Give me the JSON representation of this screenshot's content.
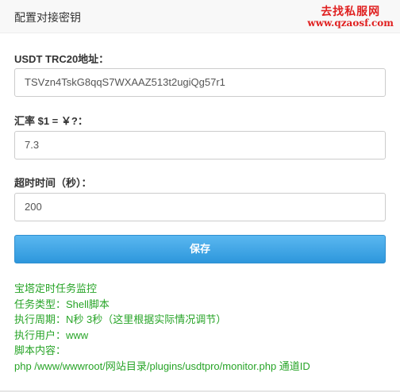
{
  "dialog": {
    "title": "配置对接密钥",
    "watermark_line1": "去找私服网",
    "watermark_line2": "www.qzaosf.com",
    "close_glyph": "×"
  },
  "form": {
    "usdt_label": "USDT TRC20地址：",
    "usdt_value": "TSVzn4TskG8qqS7WXAAZ513t2ugiQg57r1",
    "rate_label": "汇率 $1 = ￥?：",
    "rate_value": "7.3",
    "timeout_label": "超时时间（秒）：",
    "timeout_value": "200",
    "save_label": "保存"
  },
  "info_lines": [
    "宝塔定时任务监控",
    "任务类型：Shell脚本",
    "执行周期：N秒 3秒（这里根据实际情况调节）",
    "执行用户：www",
    "脚本内容：",
    "php /www/wwwroot/网站目录/plugins/usdtpro/monitor.php 通道ID"
  ],
  "colors": {
    "accent": "#2d97dc",
    "info_text": "#27a427",
    "watermark": "#e02020"
  }
}
